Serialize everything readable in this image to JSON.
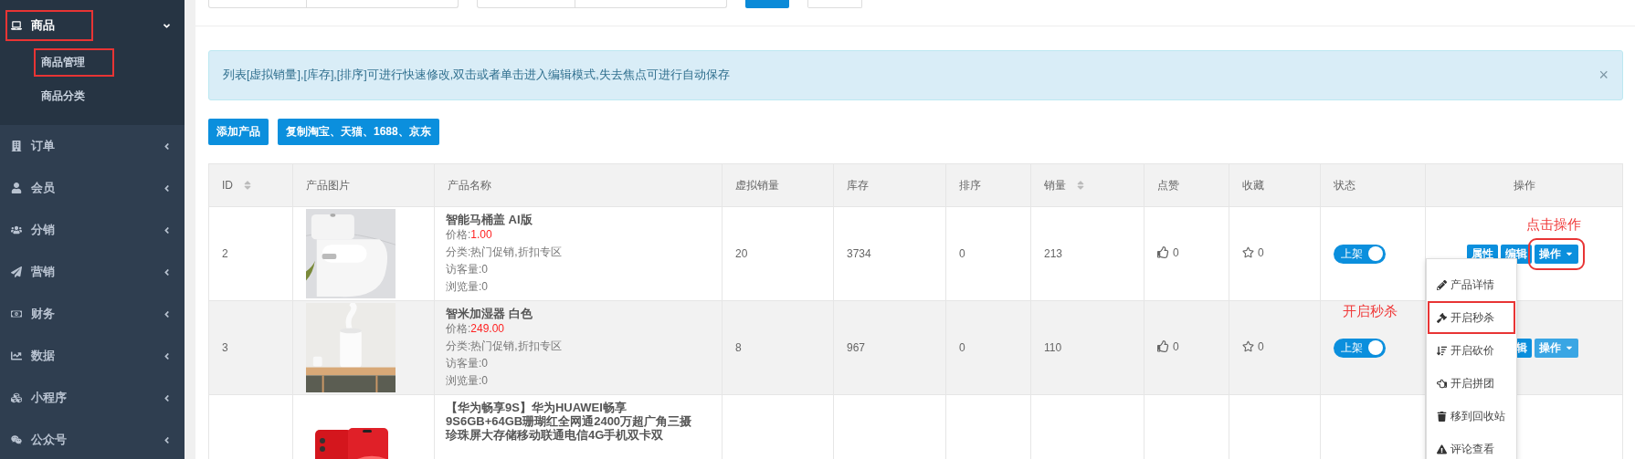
{
  "sidebar": {
    "items": [
      {
        "label": "商品",
        "expanded": true,
        "annotated": true,
        "children": [
          {
            "label": "商品管理",
            "annotated": true
          },
          {
            "label": "商品分类",
            "annotated": false
          }
        ]
      },
      {
        "label": "订单",
        "expanded": false,
        "annotated": false
      },
      {
        "label": "会员",
        "expanded": false,
        "annotated": false
      },
      {
        "label": "分销",
        "expanded": false,
        "annotated": false
      },
      {
        "label": "营销",
        "expanded": false,
        "annotated": false
      },
      {
        "label": "财务",
        "expanded": false,
        "annotated": false
      },
      {
        "label": "数据",
        "expanded": false,
        "annotated": false
      },
      {
        "label": "小程序",
        "expanded": false,
        "annotated": false
      },
      {
        "label": "公众号",
        "expanded": false,
        "annotated": false
      }
    ]
  },
  "alert": {
    "text": "列表[虚拟销量],[库存],[排序]可进行快速修改,双击或者单击进入编辑模式,失去焦点可进行自动保存",
    "close": "×"
  },
  "toolbar": {
    "buttons": [
      "添加产品",
      "复制淘宝、天猫、1688、京东"
    ]
  },
  "table": {
    "columns": [
      {
        "label": "ID",
        "sortable": true
      },
      {
        "label": "产品图片",
        "sortable": false
      },
      {
        "label": "产品名称",
        "sortable": false
      },
      {
        "label": "虚拟销量",
        "sortable": false
      },
      {
        "label": "库存",
        "sortable": false
      },
      {
        "label": "排序",
        "sortable": false
      },
      {
        "label": "销量",
        "sortable": true
      },
      {
        "label": "点赞",
        "sortable": false
      },
      {
        "label": "收藏",
        "sortable": false
      },
      {
        "label": "状态",
        "sortable": false
      },
      {
        "label": "操作",
        "sortable": false
      }
    ],
    "rows": [
      {
        "highlighted": false,
        "id": "2",
        "picture": {
          "kind": "picture"
        },
        "name": "智能马桶盖 AI版",
        "price_label": "价格:",
        "price": "1.00",
        "category": "分类:热门促销,折扣专区",
        "visitors": "访客量:0",
        "views": "浏览量:0",
        "virtual_sales": "20",
        "stock": "3734",
        "sort": "0",
        "sales": "213",
        "likes": "0",
        "favorites": "0",
        "status": {
          "label": "上架",
          "on": true
        },
        "status_note": null,
        "actions": [
          {
            "label": "属性",
            "kind": "button",
            "annotated": false
          },
          {
            "label": "编辑",
            "kind": "button",
            "annotated": false
          },
          {
            "label": "操作",
            "kind": "dropdown",
            "annotated": true,
            "faded": false
          }
        ],
        "action_note": "点击操作",
        "menu": [
          {
            "label": "产品详情",
            "annotated": false
          },
          {
            "label": "开启秒杀",
            "annotated": true
          },
          {
            "label": "开启砍价",
            "annotated": false
          },
          {
            "label": "开启拼团",
            "annotated": false
          },
          {
            "label": "移到回收站",
            "annotated": false
          },
          {
            "label": "评论查看",
            "annotated": false
          }
        ]
      },
      {
        "highlighted": true,
        "id": "3",
        "picture": {
          "kind": "picture"
        },
        "name": "智米加湿器 白色",
        "price_label": "价格:",
        "price": "249.00",
        "category": "分类:热门促销,折扣专区",
        "visitors": "访客量:0",
        "views": "浏览量:0",
        "virtual_sales": "8",
        "stock": "967",
        "sort": "0",
        "sales": "110",
        "likes": "0",
        "favorites": "0",
        "status": {
          "label": "上架",
          "on": true
        },
        "status_note": "开启秒杀",
        "actions": [
          {
            "label": "辑",
            "kind": "button",
            "annotated": false
          },
          {
            "label": "操作",
            "kind": "dropdown",
            "annotated": false,
            "faded": true
          }
        ]
      },
      {
        "highlighted": false,
        "picture": {
          "kind": "picture"
        },
        "name": "【华为畅享9S】华为HUAWEI畅享9S6GB+64GB珊瑚红全网通2400万超广角三摄珍珠屏大存储移动联通电信4G手机双卡双"
      }
    ]
  }
}
